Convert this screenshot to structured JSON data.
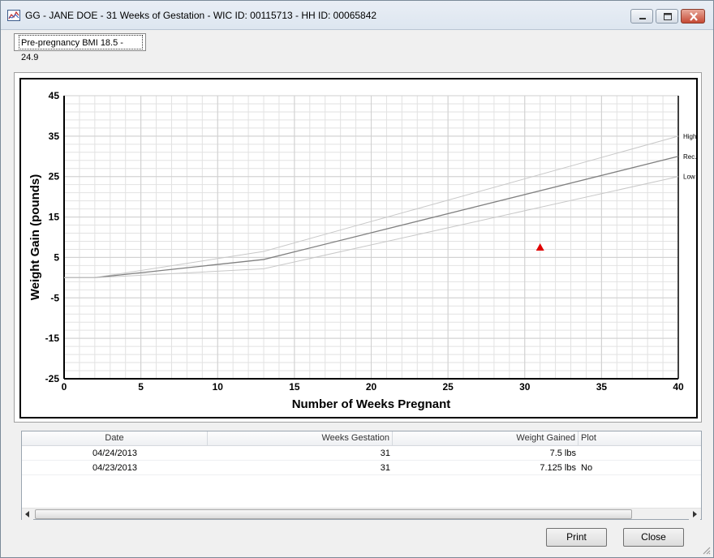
{
  "window": {
    "title": "GG - JANE DOE - 31 Weeks of Gestation - WIC ID: 00115713 - HH ID: 00065842",
    "icon": "chart-app-icon"
  },
  "tab": {
    "label": "Pre-pregnancy BMI 18.5 - 24.9"
  },
  "chart_data": {
    "type": "line",
    "title": "",
    "xlabel": "Number of Weeks Pregnant",
    "ylabel": "Weight Gain (pounds)",
    "xlim": [
      0,
      40
    ],
    "ylim": [
      -25,
      45
    ],
    "x_ticks": [
      0,
      5,
      10,
      15,
      20,
      25,
      30,
      35,
      40
    ],
    "y_ticks": [
      45,
      35,
      25,
      15,
      5,
      -5,
      -15,
      -25
    ],
    "grid": true,
    "series": [
      {
        "name": "High",
        "x": [
          0,
          2,
          13,
          40
        ],
        "y": [
          0,
          0,
          6.5,
          35
        ],
        "color": "#c8c8c8"
      },
      {
        "name": "Rec.",
        "x": [
          0,
          2,
          13,
          40
        ],
        "y": [
          0,
          0,
          4.5,
          30
        ],
        "color": "#808080"
      },
      {
        "name": "Low",
        "x": [
          0,
          2,
          13,
          40
        ],
        "y": [
          0,
          0,
          2.2,
          25
        ],
        "color": "#c8c8c8"
      }
    ],
    "points": [
      {
        "x": 31,
        "y": 7.5,
        "marker": "triangle",
        "color": "#e00000"
      }
    ]
  },
  "table": {
    "columns": [
      "Date",
      "Weeks Gestation",
      "Weight Gained",
      "Plot"
    ],
    "rows": [
      {
        "date": "04/24/2013",
        "weeks": "31",
        "weight": "7.5 lbs",
        "plot": ""
      },
      {
        "date": "04/23/2013",
        "weeks": "31",
        "weight": "7.125 lbs",
        "plot": "No"
      }
    ]
  },
  "buttons": {
    "print": "Print",
    "close": "Close"
  }
}
